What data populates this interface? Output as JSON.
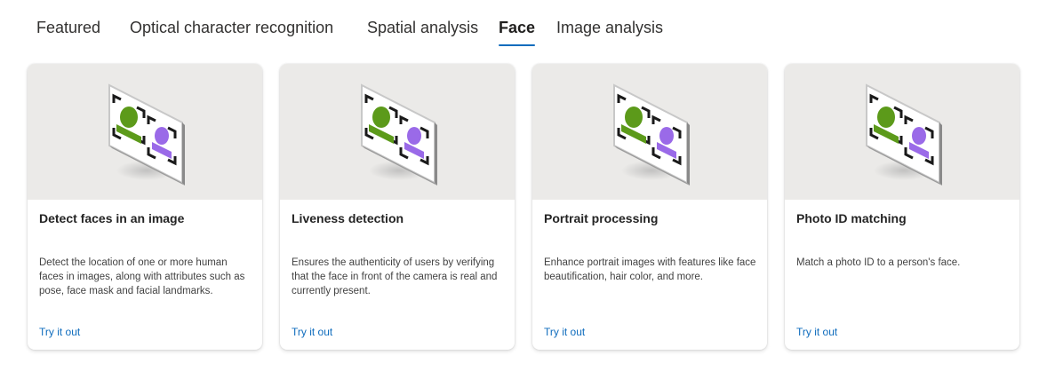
{
  "tabs": [
    {
      "label": "Featured"
    },
    {
      "label": "Optical character recognition"
    },
    {
      "label": "Spatial analysis"
    },
    {
      "label": "Face"
    },
    {
      "label": "Image analysis"
    }
  ],
  "active_tab": "Face",
  "cards": [
    {
      "title": "Detect faces in an image",
      "description": "Detect the location of one or more human faces in images, along with attributes such as pose, face mask and facial landmarks.",
      "link": "Try it out",
      "icon": "face-detection-icon"
    },
    {
      "title": "Liveness detection",
      "description": "Ensures the authenticity of users by verifying that the face in front of the camera is real and currently present.",
      "link": "Try it out",
      "icon": "face-detection-icon"
    },
    {
      "title": "Portrait processing",
      "description": "Enhance portrait images with features like face beautification, hair color, and more.",
      "link": "Try it out",
      "icon": "face-detection-icon"
    },
    {
      "title": "Photo ID matching",
      "description": "Match a photo ID to a person's face.",
      "link": "Try it out",
      "icon": "face-detection-icon"
    }
  ],
  "colors": {
    "accent": "#0f6cbd",
    "hero_bg": "#ebeae8",
    "face_green": "#5c9a1a",
    "face_purple": "#9a6ae8"
  }
}
